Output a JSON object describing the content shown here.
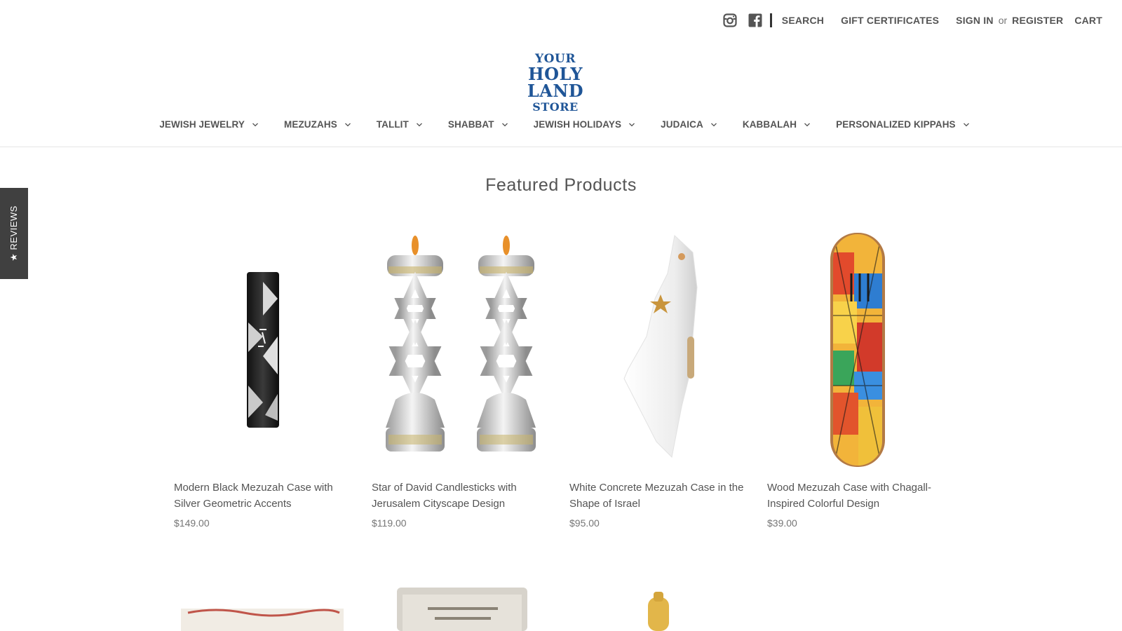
{
  "header": {
    "social": [
      {
        "name": "instagram-icon"
      },
      {
        "name": "facebook-icon"
      }
    ],
    "nav": {
      "search": "SEARCH",
      "gift": "GIFT CERTIFICATES",
      "signin": "SIGN IN",
      "or": "or",
      "register": "REGISTER",
      "cart": "CART"
    },
    "logo": {
      "line1": "YOUR",
      "line2": "HOLY LAND",
      "line3": "STORE",
      "color": "#1f5597"
    }
  },
  "main_nav": [
    {
      "label": "JEWISH JEWELRY"
    },
    {
      "label": "MEZUZAHS"
    },
    {
      "label": "TALLIT"
    },
    {
      "label": "SHABBAT"
    },
    {
      "label": "JEWISH HOLIDAYS"
    },
    {
      "label": "JUDAICA"
    },
    {
      "label": "KABBALAH"
    },
    {
      "label": "PERSONALIZED KIPPAHS"
    }
  ],
  "reviews_tab": {
    "label": "★ REVIEWS"
  },
  "featured": {
    "heading": "Featured Products",
    "products": [
      {
        "title": "Modern Black Mezuzah Case with Silver Geometric Accents",
        "price": "$149.00"
      },
      {
        "title": "Star of David Candlesticks with Jerusalem Cityscape Design",
        "price": "$119.00"
      },
      {
        "title": "White Concrete Mezuzah Case in the Shape of Israel",
        "price": "$95.00"
      },
      {
        "title": "Wood Mezuzah Case with Chagall-Inspired Colorful Design",
        "price": "$39.00"
      }
    ]
  },
  "colors": {
    "brand": "#1f5597",
    "text": "#545454",
    "reviews_tab": "#404040"
  }
}
